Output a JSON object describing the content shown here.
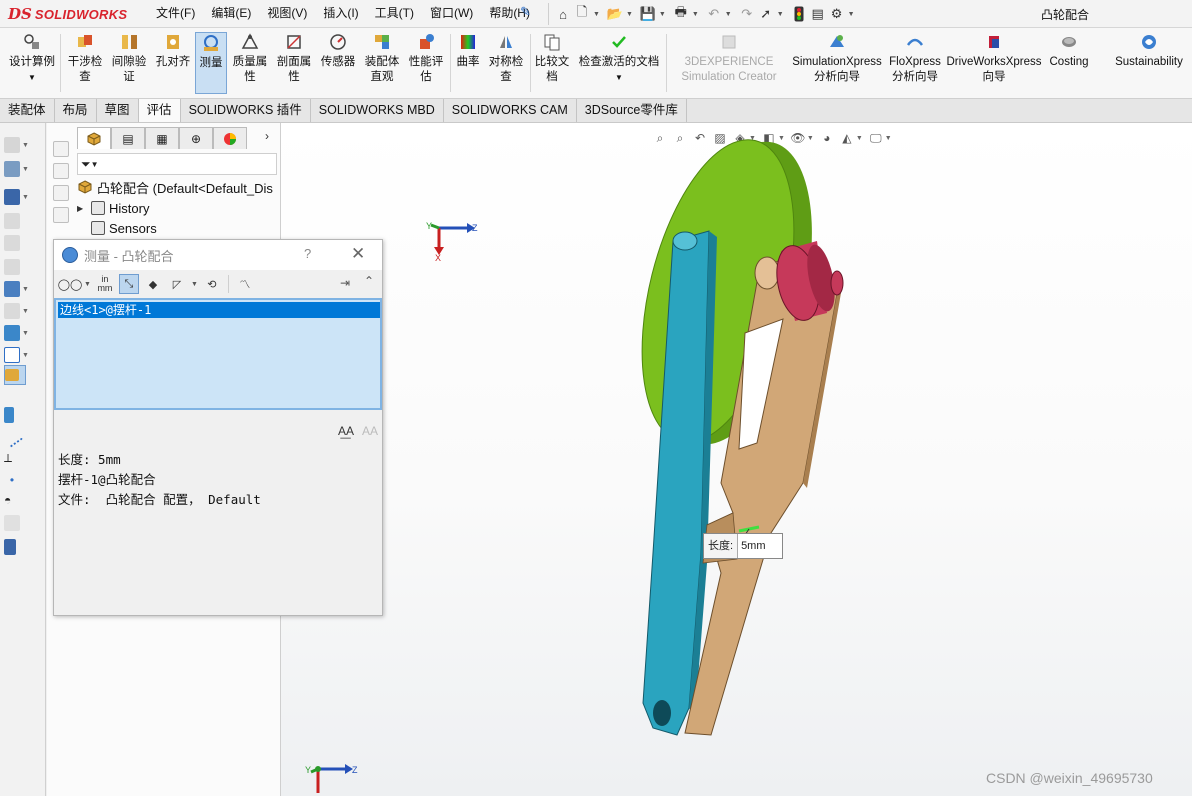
{
  "app": {
    "brand_ds": "DS",
    "brand_sw": "SOLIDWORKS",
    "window_title": "凸轮配合"
  },
  "menu": {
    "items": [
      "文件(F)",
      "编辑(E)",
      "视图(V)",
      "插入(I)",
      "工具(T)",
      "窗口(W)",
      "帮助(H)"
    ]
  },
  "ribbon": {
    "design_study": "设计算例",
    "interference": "干涉检\n查",
    "clearance": "间隙验\n证",
    "hole_align": "孔对齐",
    "measure": "测量",
    "mass_props": "质量属\n性",
    "section_props": "剖面属\n性",
    "sensor": "传感器",
    "asm_visual": "装配体\n直观",
    "performance": "性能评\n估",
    "curvature": "曲率",
    "symmetry": "对称检\n查",
    "compare": "比较文\n档",
    "check_active": "检查激活的文档",
    "exp_line1": "3DEXPERIENCE",
    "exp_line2": "Simulation Creator",
    "simxpress": "SimulationXpress\n分析向导",
    "floxpress": "FloXpress\n分析向导",
    "driveworks": "DriveWorksXpress\n向导",
    "costing": "Costing",
    "sustainability": "Sustainability"
  },
  "tabs": [
    "装配体",
    "布局",
    "草图",
    "评估",
    "SOLIDWORKS 插件",
    "SOLIDWORKS MBD",
    "SOLIDWORKS CAM",
    "3DSource零件库"
  ],
  "active_tab_index": 3,
  "feature_tree": {
    "root": "凸轮配合  (Default<Default_Dis",
    "history": "History",
    "sensors": "Sensors"
  },
  "measure_dialog": {
    "title": "测量 - 凸轮配合",
    "help": "?",
    "close": "✕",
    "selection": "边线<1>@摆杆-1",
    "results": "长度: 5mm\n摆杆-1@凸轮配合\n文件:  凸轮配合 配置， Default",
    "font_large": "A͟A",
    "font_small": "AA"
  },
  "callout": {
    "label": "长度:",
    "value": "5mm"
  },
  "triad": {
    "x": "X",
    "y": "Y",
    "z": "Z"
  },
  "watermark": "CSDN @weixin_49695730",
  "colors": {
    "cam": "#7bbf1e",
    "link_blue": "#2aa4bf",
    "rocker_tan": "#d1a777",
    "roller": "#c6395a",
    "accent": "#0078d7"
  }
}
